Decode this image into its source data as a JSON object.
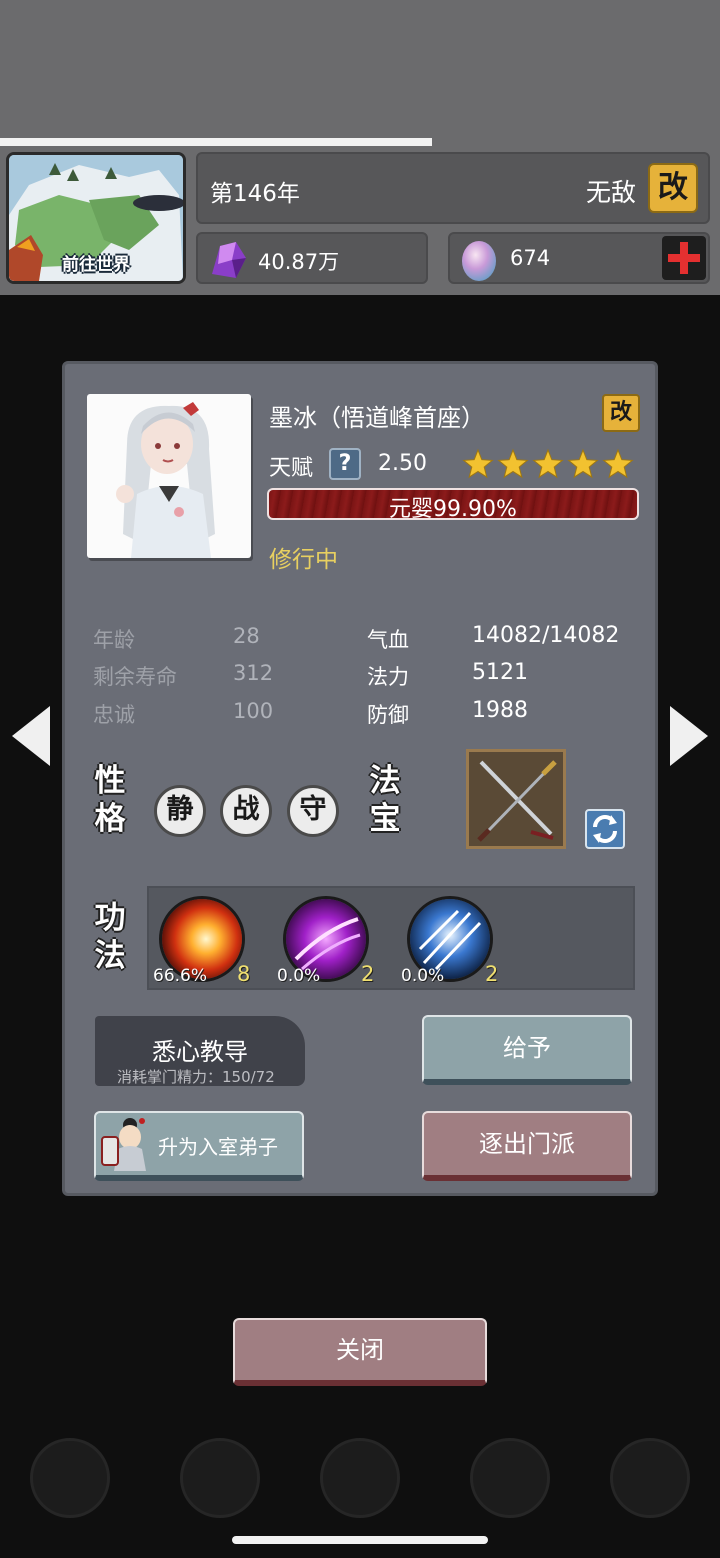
{
  "header": {
    "world_button_label": "前往世界",
    "year": "第146年",
    "sect_title": "无敌",
    "rename_label": "改",
    "spirit_stones": "40.87万",
    "gems": "674"
  },
  "disciple": {
    "name": "墨冰（悟道峰首座）",
    "rename_label": "改",
    "talent_label": "天赋",
    "talent_help": "?",
    "talent_value": "2.50",
    "stars": 5,
    "realm_progress_percent": 99.9,
    "realm_text": "元婴99.90%",
    "status": "修行中"
  },
  "stats": {
    "age_label": "年龄",
    "age": "28",
    "lifespan_label": "剩余寿命",
    "lifespan": "312",
    "loyalty_label": "忠诚",
    "loyalty": "100",
    "hp_label": "气血",
    "hp": "14082/14082",
    "mana_label": "法力",
    "mana": "5121",
    "defense_label": "防御",
    "defense": "1988"
  },
  "personality": {
    "title": "性格",
    "traits": [
      "静",
      "战",
      "守"
    ]
  },
  "artifact": {
    "title": "法宝",
    "item_icon": "crossed-swords-icon"
  },
  "techniques": {
    "title": "功法",
    "skills": [
      {
        "icon": "fire-explosion-icon",
        "progress": "66.6%",
        "level": "8"
      },
      {
        "icon": "purple-slash-icon",
        "progress": "0.0%",
        "level": "2"
      },
      {
        "icon": "ice-blades-icon",
        "progress": "0.0%",
        "level": "2"
      }
    ]
  },
  "actions": {
    "teach_label": "悉心教导",
    "teach_cost": "消耗掌门精力：150/72",
    "give_label": "给予",
    "promote_label": "升为入室弟子",
    "expel_label": "逐出门派"
  },
  "close_label": "关闭",
  "colors": {
    "accent_gold": "#e6b23a",
    "status_yellow": "#e8d060",
    "realm_bar_red": "#7a1414",
    "dialog_bg": "#6a6d76"
  }
}
